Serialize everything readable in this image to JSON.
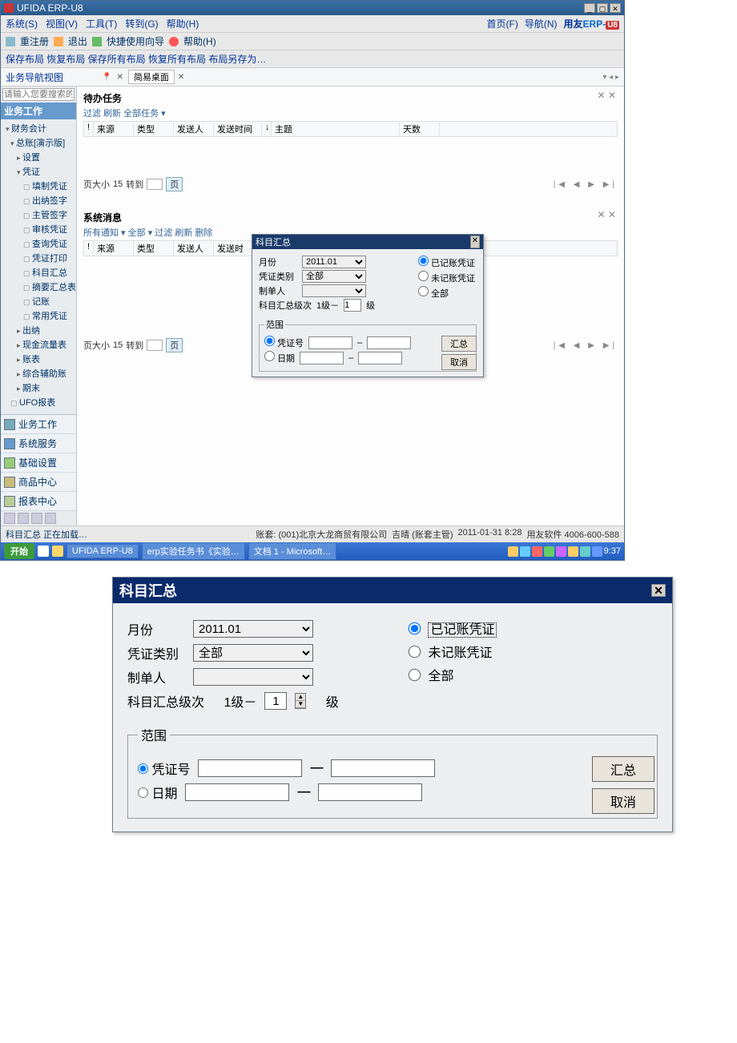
{
  "window": {
    "title": "UFIDA ERP-U8"
  },
  "menubar": {
    "items": [
      "系统(S)",
      "视图(V)",
      "工具(T)",
      "转到(G)",
      "帮助(H)"
    ],
    "right": {
      "home": "首页(F)",
      "find": "导航(N)"
    },
    "brand": {
      "pre": "用友",
      "erp": "ERP-",
      "suf": "U8"
    }
  },
  "toolbar1": {
    "rereg": "重注册",
    "exit": "退出",
    "shortcut": "快捷使用向导",
    "help": "帮助(H)"
  },
  "toolbar2": {
    "text": "保存布局  恢复布局  保存所有布局  恢复所有布局  布局另存为…"
  },
  "navhead": {
    "label": "业务导航视图"
  },
  "search": {
    "placeholder": "请输入您要搜索的功能"
  },
  "sidebar": {
    "header": "业务工作",
    "tree": {
      "fin": "财务会计",
      "gl": "总账[演示版]",
      "set": "设置",
      "vch": "凭证",
      "v_fill": "填制凭证",
      "v_cash": "出纳签字",
      "v_sup": "主管签字",
      "v_aud": "审核凭证",
      "v_qry": "查询凭证",
      "v_prn": "凭证打印",
      "v_sum": "科目汇总",
      "v_bal": "摘要汇总表",
      "v_post": "记账",
      "v_cmn": "常用凭证",
      "cashier": "出纳",
      "cash_flow": "现金流量表",
      "books": "账表",
      "aux": "综合辅助账",
      "pend": "期末",
      "ufo": "UFO报表"
    },
    "groups": {
      "biz": "业务工作",
      "sys": "系统服务",
      "base": "基础设置",
      "mall": "商品中心",
      "rpt": "报表中心"
    }
  },
  "tabs": {
    "desktop": "简易桌面"
  },
  "pending": {
    "title": "待办任务",
    "filter": "过滤  刷新  全部任务 ▾",
    "cols": {
      "src": "来源",
      "type": "类型",
      "sender": "发送人",
      "time": "发送时间",
      "subj": "主题",
      "days": "天数"
    }
  },
  "sysmsg": {
    "title": "系统消息",
    "filter": "所有通知 ▾  全部 ▾  过滤  刷新  删除",
    "cols": {
      "src": "来源",
      "type": "类型",
      "sender": "发送人",
      "time": "发送时"
    }
  },
  "pager": {
    "size_lab": "页大小",
    "size": "15",
    "goto": "转到",
    "page_suf": "页"
  },
  "pager_nav": "|◀  ◀  ▶  ▶|",
  "panel_x": "✕ ✕",
  "dlg": {
    "title": "科目汇总",
    "month_lab": "月份",
    "month_val": "2011.01",
    "type_lab": "凭证类别",
    "type_val": "全部",
    "maker_lab": "制单人",
    "maker_val": "",
    "level_lab": "科目汇总级次",
    "level_pref": "1级－",
    "level_val": "1",
    "level_suf": "级",
    "radios": {
      "posted": "已记账凭证",
      "unposted": "未记账凭证",
      "all": "全部"
    },
    "range": {
      "legend": "范围",
      "by_no": "凭证号",
      "by_date": "日期"
    },
    "btn_sum": "汇总",
    "btn_cancel": "取消"
  },
  "status": {
    "loading": "科目汇总 正在加载…",
    "right": {
      "org": "账套: (001)北京大龙商贸有限公司",
      "user": "吉晴 (账套主管)",
      "date": "2011-01-31 8:28",
      "svc": "用友软件 4006-600-588"
    }
  },
  "taskbar": {
    "start": "开始",
    "apps": [
      "UFIDA ERP-U8",
      "erp实验任务书《实验…",
      "文档 1 - Microsoft…"
    ],
    "clock": "9:37"
  }
}
